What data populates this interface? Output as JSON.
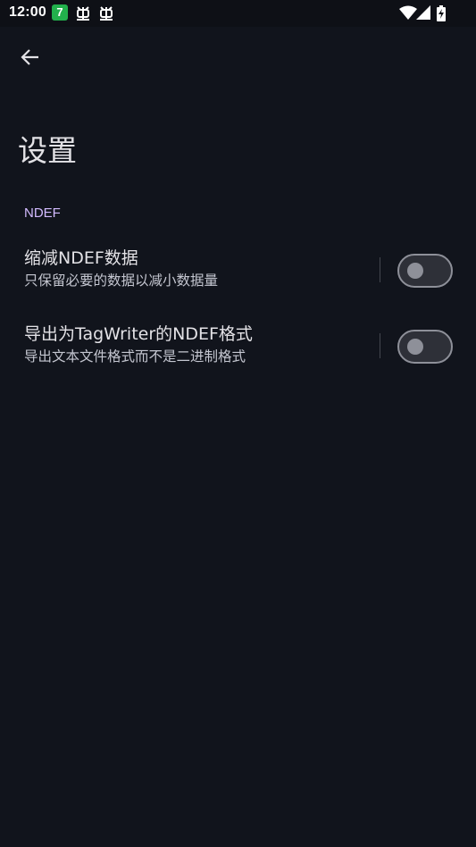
{
  "status_bar": {
    "time": "12:00",
    "notification_badge": "7",
    "icons": [
      "bug-icon",
      "bug-icon",
      "wifi-icon",
      "cell-signal-icon",
      "battery-charging-icon"
    ]
  },
  "app_bar": {
    "back_icon": "arrow-back-icon",
    "title": "设置"
  },
  "category": {
    "title": "NDEF"
  },
  "preferences": [
    {
      "title": "缩减NDEF数据",
      "summary": "只保留必要的数据以减小数据量",
      "enabled": false
    },
    {
      "title": "导出为TagWriter的NDEF格式",
      "summary": "导出文本文件格式而不是二进制格式",
      "enabled": false
    }
  ],
  "colors": {
    "background": "#11141c",
    "accent": "#d3bbff",
    "badge": "#22b04c"
  }
}
